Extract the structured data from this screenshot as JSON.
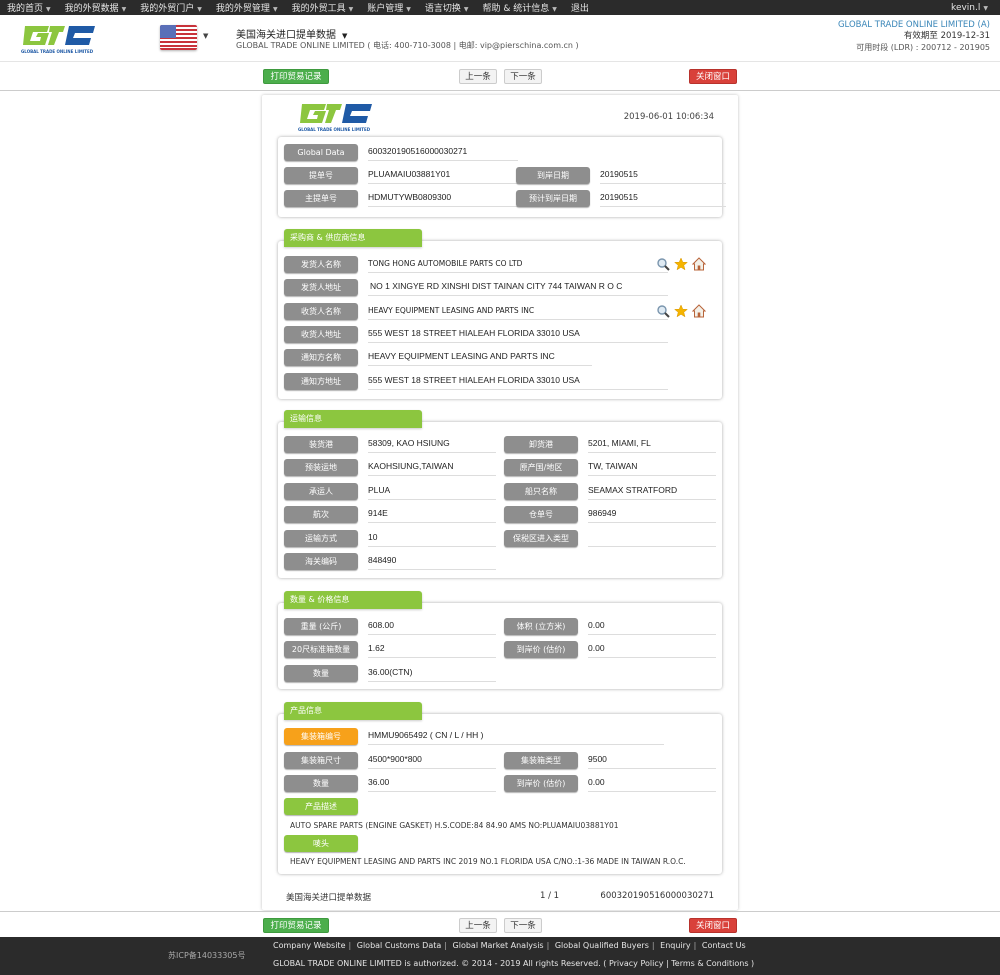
{
  "topnav": {
    "items": [
      "我的首页",
      "我的外贸数据",
      "我的外贸门户",
      "我的外贸管理",
      "我的外贸工具",
      "账户管理",
      "语言切换",
      "帮助 & 统计信息",
      "退出"
    ],
    "has_caret": [
      true,
      true,
      true,
      true,
      true,
      true,
      true,
      true,
      false
    ],
    "user": "kevin.l"
  },
  "header": {
    "logo_text": "GLOBAL TRADE ONLINE LIMITED",
    "flag": "us-flag",
    "db_title": "美国海关进口提单数据",
    "company_line": "GLOBAL TRADE ONLINE LIMITED ( 电话: 400-710-3008 | 电邮: vip@pierschina.com.cn )",
    "right_company": "GLOBAL TRADE ONLINE LIMITED (A)",
    "valid_until": "有效期至 2019-12-31",
    "ldr": "可用时段 (LDR) : 200712 - 201905"
  },
  "toolbar": {
    "print": "打印贸易记录",
    "prev": "上一条",
    "next": "下一条",
    "close": "关闭窗口"
  },
  "record": {
    "timestamp": "2019-06-01 10:06:34",
    "basic": {
      "global_data_label": "Global Data",
      "global_data": "600320190516000030271",
      "bl_label": "提单号",
      "bl": "PLUAMAIU03881Y01",
      "arrival_label": "到岸日期",
      "arrival": "20190515",
      "master_bl_label": "主提单号",
      "master_bl": "HDMUTYWB0809300",
      "est_arrival_label": "预计到岸日期",
      "est_arrival": "20190515"
    },
    "parties": {
      "title": "采购商 & 供应商信息",
      "rows": [
        {
          "label": "发货人名称",
          "value": "TONG HONG AUTOMOBILE PARTS CO LTD",
          "icons": true
        },
        {
          "label": "发货人地址",
          "value": "NO 1 XINGYE RD XINSHI DIST TAINAN CITY 744 TAIWAN R O C",
          "icons": false
        },
        {
          "label": "收货人名称",
          "value": "HEAVY EQUIPMENT LEASING AND PARTS INC",
          "icons": true
        },
        {
          "label": "收货人地址",
          "value": "555 WEST 18 STREET HIALEAH FLORIDA 33010 USA",
          "icons": false
        },
        {
          "label": "通知方名称",
          "value": "HEAVY EQUIPMENT LEASING AND PARTS INC",
          "icons": false
        },
        {
          "label": "通知方地址",
          "value": "555 WEST 18 STREET HIALEAH FLORIDA 33010 USA",
          "icons": false
        }
      ]
    },
    "transport": {
      "title": "运输信息",
      "rows": [
        [
          {
            "label": "装货港",
            "value": "58309, KAO HSIUNG"
          },
          {
            "label": "卸货港",
            "value": "5201, MIAMI, FL"
          }
        ],
        [
          {
            "label": "预装运地",
            "value": "KAOHSIUNG,TAIWAN"
          },
          {
            "label": "原产国/地区",
            "value": "TW, TAIWAN"
          }
        ],
        [
          {
            "label": "承运人",
            "value": "PLUA"
          },
          {
            "label": "船只名称",
            "value": "SEAMAX STRATFORD"
          }
        ],
        [
          {
            "label": "航次",
            "value": "914E"
          },
          {
            "label": "仓单号",
            "value": "986949"
          }
        ],
        [
          {
            "label": "运输方式",
            "value": "10"
          },
          {
            "label": "保税区进入类型",
            "value": ""
          }
        ],
        [
          {
            "label": "海关编码",
            "value": "848490"
          }
        ]
      ]
    },
    "quantity": {
      "title": "数量 & 价格信息",
      "rows": [
        [
          {
            "label": "重量 (公斤)",
            "value": "608.00"
          },
          {
            "label": "体积 (立方米)",
            "value": "0.00"
          }
        ],
        [
          {
            "label": "20尺标准箱数量",
            "value": "1.62"
          },
          {
            "label": "到岸价 (估价)",
            "value": "0.00"
          }
        ],
        [
          {
            "label": "数量",
            "value": "36.00(CTN)"
          }
        ]
      ]
    },
    "product": {
      "title": "产品信息",
      "container_no_label": "集装箱编号",
      "container_no": "HMMU9065492 ( CN / L / HH )",
      "rows": [
        [
          {
            "label": "集装箱尺寸",
            "value": "4500*900*800"
          },
          {
            "label": "集装箱类型",
            "value": "9500"
          }
        ],
        [
          {
            "label": "数量",
            "value": "36.00"
          },
          {
            "label": "到岸价 (估价)",
            "value": "0.00"
          }
        ]
      ],
      "desc_label": "产品描述",
      "desc": "AUTO SPARE PARTS (ENGINE GASKET) H.S.CODE:84 84.90 AMS NO:PLUAMAIU03881Y01",
      "marks_label": "唛头",
      "marks": "HEAVY EQUIPMENT LEASING AND PARTS INC 2019 NO.1 FLORIDA USA C/NO.:1-36 MADE IN TAIWAN R.O.C."
    },
    "footer": {
      "source": "美国海关进口提单数据",
      "page": "1 / 1",
      "id": "600320190516000030271"
    }
  },
  "footer": {
    "icp": "苏ICP备14033305号",
    "links": [
      "Company Website",
      "Global Customs Data",
      "Global Market Analysis",
      "Global Qualified Buyers",
      "Enquiry",
      "Contact Us"
    ],
    "copyright": "GLOBAL TRADE ONLINE LIMITED is authorized. © 2014 - 2019 All rights Reserved.",
    "privacy": "Privacy Policy",
    "terms": "Terms & Conditions"
  },
  "colors": {
    "nav_bg": "#2b2b2b",
    "accent_green": "#8cc63f",
    "label_gray": "#8e8e8e",
    "label_orange": "#f7a11a",
    "print_green": "#4cae4c",
    "close_red": "#d9413a",
    "brand_blue": "#3a86b8"
  }
}
